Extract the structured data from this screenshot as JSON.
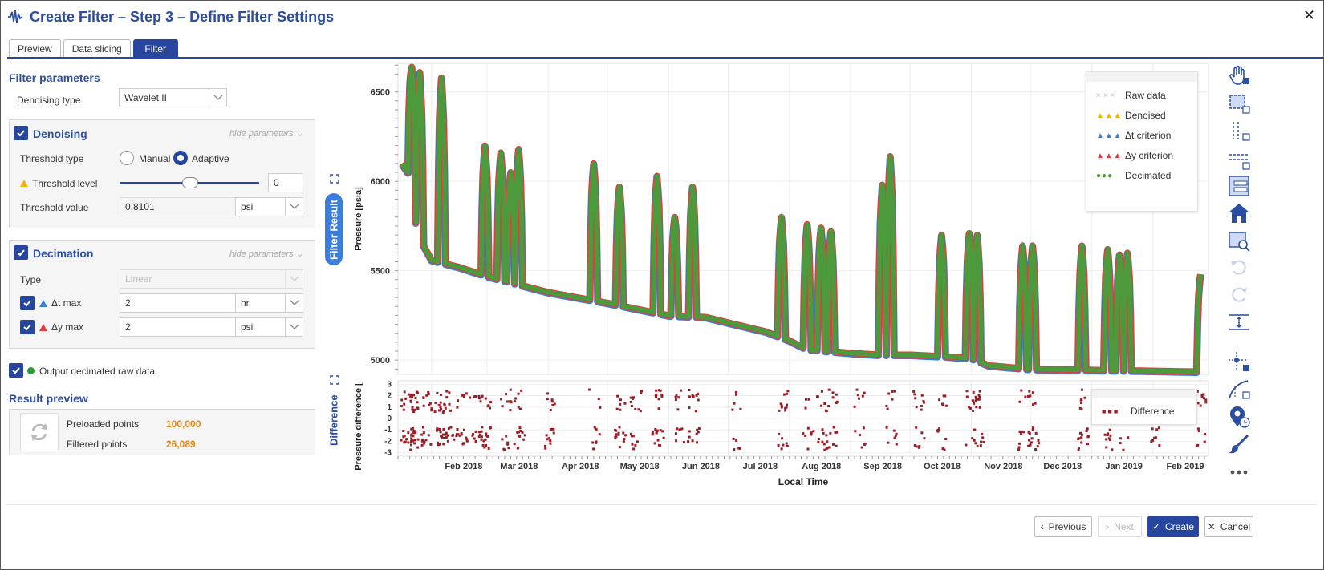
{
  "window": {
    "title": "Create Filter – Step 3 – Define Filter Settings",
    "close": "✕"
  },
  "tabs": [
    {
      "label": "Preview"
    },
    {
      "label": "Data slicing"
    },
    {
      "label": "Filter"
    }
  ],
  "filter_params": {
    "title": "Filter parameters",
    "denoising_type_label": "Denoising type",
    "denoising_type_value": "Wavelet II"
  },
  "denoising": {
    "title": "Denoising",
    "hide": "hide parameters",
    "threshold_type_label": "Threshold type",
    "manual": "Manual",
    "adaptive": "Adaptive",
    "threshold_level_label": "Threshold level",
    "threshold_level_value": "0",
    "threshold_value_label": "Threshold value",
    "threshold_value": "0.8101",
    "threshold_unit": "psi"
  },
  "decimation": {
    "title": "Decimation",
    "hide": "hide parameters",
    "type_label": "Type",
    "type_value": "Linear",
    "dt_label": "Δt max",
    "dt_value": "2",
    "dt_unit": "hr",
    "dy_label": "Δy max",
    "dy_value": "2",
    "dy_unit": "psi"
  },
  "output_label": "Output decimated raw data",
  "result_preview": {
    "title": "Result preview",
    "preloaded_label": "Preloaded points",
    "preloaded_value": "100,000",
    "filtered_label": "Filtered points",
    "filtered_value": "26,089"
  },
  "side_tabs": {
    "filter_result": "Filter Result",
    "difference": "Difference"
  },
  "footer": {
    "previous": "Previous",
    "next": "Next",
    "create": "Create",
    "cancel": "Cancel"
  },
  "colors": {
    "accent": "#2646a0",
    "decimated": "#4c9a3c",
    "raw": "#bbbbbb",
    "denoised": "#f0b400",
    "dt_criterion": "#3b7ddd",
    "dy_criterion": "#e03c3c",
    "difference": "#9b1c24",
    "orange": "#e08a1e"
  },
  "chart_data": [
    {
      "type": "line",
      "ylabel": "Pressure [psia]",
      "ylim": [
        4920,
        6660
      ],
      "yticks": [
        5000,
        5500,
        6000,
        6500
      ],
      "legend": [
        "Raw data",
        "Denoised",
        "Δt criterion",
        "Δy criterion",
        "Decimated"
      ],
      "legend_position": "top-right",
      "grid": true,
      "baseline": {
        "x": [
          "2018-01-17",
          "2018-01-20",
          "2018-01-25",
          "2018-02-01",
          "2018-02-15",
          "2018-03-01",
          "2018-04-01",
          "2018-05-01",
          "2018-06-01",
          "2018-06-20",
          "2018-07-01",
          "2018-07-20",
          "2018-08-01",
          "2018-08-10",
          "2018-09-01",
          "2018-09-15",
          "2018-10-01",
          "2018-10-20",
          "2018-11-01",
          "2018-11-10",
          "2018-12-01",
          "2019-01-01",
          "2019-02-01",
          "2019-02-25"
        ],
        "y": [
          6100,
          6050,
          5700,
          5560,
          5520,
          5470,
          5380,
          5320,
          5250,
          5240,
          5210,
          5160,
          5110,
          5060,
          5040,
          5030,
          5030,
          5020,
          5010,
          4970,
          4950,
          4945,
          4940,
          4935
        ]
      },
      "spikes": [
        {
          "x": "2018-01-22",
          "y": 6640
        },
        {
          "x": "2018-01-26",
          "y": 6610
        },
        {
          "x": "2018-02-06",
          "y": 6580
        },
        {
          "x": "2018-02-28",
          "y": 6200
        },
        {
          "x": "2018-03-08",
          "y": 6160
        },
        {
          "x": "2018-03-13",
          "y": 6050
        },
        {
          "x": "2018-03-17",
          "y": 6180
        },
        {
          "x": "2018-04-24",
          "y": 6100
        },
        {
          "x": "2018-05-07",
          "y": 5970
        },
        {
          "x": "2018-05-26",
          "y": 6030
        },
        {
          "x": "2018-06-04",
          "y": 5800
        },
        {
          "x": "2018-06-13",
          "y": 5970
        },
        {
          "x": "2018-07-28",
          "y": 5800
        },
        {
          "x": "2018-08-10",
          "y": 5760
        },
        {
          "x": "2018-08-17",
          "y": 5740
        },
        {
          "x": "2018-08-22",
          "y": 5720
        },
        {
          "x": "2018-09-17",
          "y": 5980
        },
        {
          "x": "2018-09-21",
          "y": 6140
        },
        {
          "x": "2018-10-17",
          "y": 5700
        },
        {
          "x": "2018-10-31",
          "y": 5710
        },
        {
          "x": "2018-11-04",
          "y": 5700
        },
        {
          "x": "2018-11-27",
          "y": 5640
        },
        {
          "x": "2018-12-02",
          "y": 5640
        },
        {
          "x": "2018-12-27",
          "y": 5640
        },
        {
          "x": "2019-01-09",
          "y": 5620
        },
        {
          "x": "2019-01-15",
          "y": 5590
        },
        {
          "x": "2019-01-19",
          "y": 5600
        },
        {
          "x": "2019-02-25",
          "y": 5480
        }
      ]
    },
    {
      "type": "scatter",
      "xlabel": "Local Time",
      "ylabel": "Pressure difference [",
      "ylim": [
        -3.3,
        3.3
      ],
      "yticks": [
        3,
        2,
        1,
        0,
        -1,
        -2,
        -3
      ],
      "xlim": [
        "2018-01-15",
        "2019-03-01"
      ],
      "xticks": [
        "Feb 2018",
        "Mar 2018",
        "Apr 2018",
        "May 2018",
        "Jun 2018",
        "Jul 2018",
        "Aug 2018",
        "Sep 2018",
        "Oct 2018",
        "Nov 2018",
        "Dec 2018",
        "Jan 2019",
        "Feb 2019"
      ],
      "legend": [
        "Difference"
      ],
      "series": [
        {
          "name": "Difference",
          "color": "#9b1c24"
        }
      ],
      "cluster_dates": [
        "2018-01-22",
        "2018-02-06",
        "2018-02-28",
        "2018-03-10",
        "2018-03-17",
        "2018-04-01",
        "2018-04-24",
        "2018-05-07",
        "2018-05-15",
        "2018-05-26",
        "2018-06-06",
        "2018-06-13",
        "2018-07-05",
        "2018-07-28",
        "2018-08-10",
        "2018-08-17",
        "2018-08-22",
        "2018-09-05",
        "2018-09-21",
        "2018-10-05",
        "2018-10-17",
        "2018-10-31",
        "2018-11-04",
        "2018-11-27",
        "2018-12-02",
        "2018-12-27",
        "2019-01-09",
        "2019-01-17",
        "2019-02-01",
        "2019-02-25"
      ]
    }
  ]
}
